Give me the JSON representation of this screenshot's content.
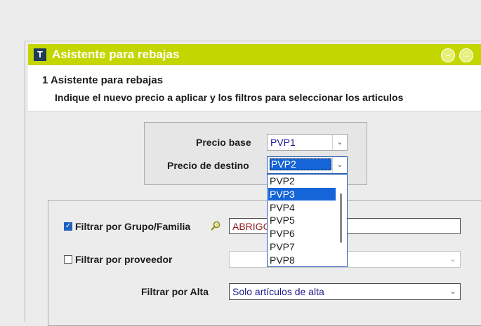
{
  "window": {
    "title": "Asistente para rebajas",
    "app_icon": "T",
    "minimize_glyph": "–",
    "maximize_glyph": "□"
  },
  "header": {
    "step_title": "1  Asistente para rebajas",
    "description": "Indique el nuevo precio a aplicar y los filtros para seleccionar los articulos"
  },
  "price": {
    "base_label": "Precio base",
    "base_value": "PVP1",
    "dest_label": "Precio de destino",
    "dest_value": "PVP2"
  },
  "dropdown": {
    "options": [
      "PVP2",
      "PVP3",
      "PVP4",
      "PVP5",
      "PVP6",
      "PVP7",
      "PVP8"
    ],
    "highlighted": "PVP3"
  },
  "filters": {
    "group_label": "Filtrar por Grupo/Familia",
    "group_checked": true,
    "group_value": "ABRIGOS",
    "supplier_label": "Filtrar por proveedor",
    "supplier_checked": false,
    "supplier_value": "",
    "alta_label": "Filtrar por Alta",
    "alta_value": "Solo artículos de alta"
  },
  "colors": {
    "titlebar": "#c4d600",
    "selection": "#1565d8",
    "checkbox_checked": "#1e5fbf"
  }
}
